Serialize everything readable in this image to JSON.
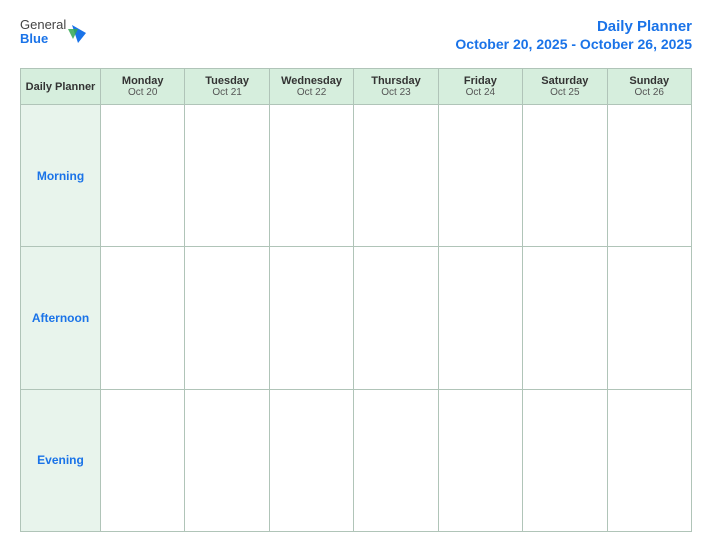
{
  "header": {
    "logo": {
      "general": "General",
      "blue": "Blue"
    },
    "title": "Daily Planner",
    "date_range": "October 20, 2025 - October 26, 2025"
  },
  "table": {
    "label_column": "Daily Planner",
    "days": [
      {
        "name": "Monday",
        "date": "Oct 20"
      },
      {
        "name": "Tuesday",
        "date": "Oct 21"
      },
      {
        "name": "Wednesday",
        "date": "Oct 22"
      },
      {
        "name": "Thursday",
        "date": "Oct 23"
      },
      {
        "name": "Friday",
        "date": "Oct 24"
      },
      {
        "name": "Saturday",
        "date": "Oct 25"
      },
      {
        "name": "Sunday",
        "date": "Oct 26"
      }
    ],
    "rows": [
      "Morning",
      "Afternoon",
      "Evening"
    ]
  }
}
